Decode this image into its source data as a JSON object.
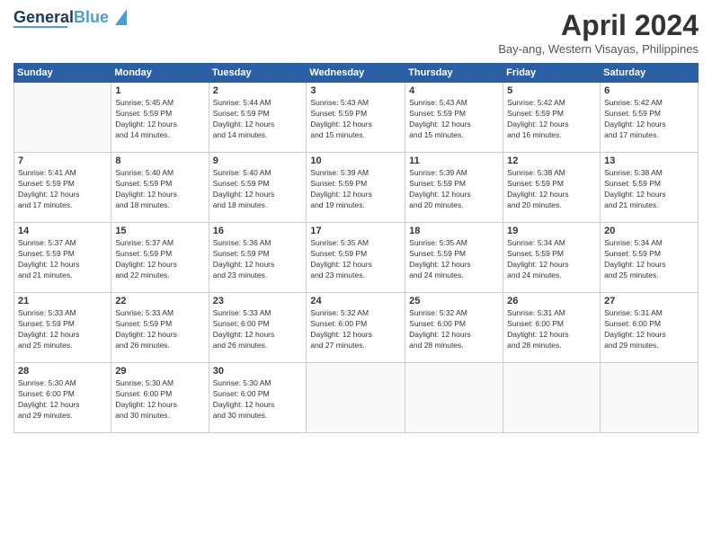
{
  "logo": {
    "line1": "General",
    "line2": "Blue"
  },
  "header": {
    "title": "April 2024",
    "subtitle": "Bay-ang, Western Visayas, Philippines"
  },
  "days_of_week": [
    "Sunday",
    "Monday",
    "Tuesday",
    "Wednesday",
    "Thursday",
    "Friday",
    "Saturday"
  ],
  "weeks": [
    [
      {
        "day": "",
        "info": ""
      },
      {
        "day": "1",
        "info": "Sunrise: 5:45 AM\nSunset: 5:59 PM\nDaylight: 12 hours\nand 14 minutes."
      },
      {
        "day": "2",
        "info": "Sunrise: 5:44 AM\nSunset: 5:59 PM\nDaylight: 12 hours\nand 14 minutes."
      },
      {
        "day": "3",
        "info": "Sunrise: 5:43 AM\nSunset: 5:59 PM\nDaylight: 12 hours\nand 15 minutes."
      },
      {
        "day": "4",
        "info": "Sunrise: 5:43 AM\nSunset: 5:59 PM\nDaylight: 12 hours\nand 15 minutes."
      },
      {
        "day": "5",
        "info": "Sunrise: 5:42 AM\nSunset: 5:59 PM\nDaylight: 12 hours\nand 16 minutes."
      },
      {
        "day": "6",
        "info": "Sunrise: 5:42 AM\nSunset: 5:59 PM\nDaylight: 12 hours\nand 17 minutes."
      }
    ],
    [
      {
        "day": "7",
        "info": "Sunrise: 5:41 AM\nSunset: 5:59 PM\nDaylight: 12 hours\nand 17 minutes."
      },
      {
        "day": "8",
        "info": "Sunrise: 5:40 AM\nSunset: 5:59 PM\nDaylight: 12 hours\nand 18 minutes."
      },
      {
        "day": "9",
        "info": "Sunrise: 5:40 AM\nSunset: 5:59 PM\nDaylight: 12 hours\nand 18 minutes."
      },
      {
        "day": "10",
        "info": "Sunrise: 5:39 AM\nSunset: 5:59 PM\nDaylight: 12 hours\nand 19 minutes."
      },
      {
        "day": "11",
        "info": "Sunrise: 5:39 AM\nSunset: 5:59 PM\nDaylight: 12 hours\nand 20 minutes."
      },
      {
        "day": "12",
        "info": "Sunrise: 5:38 AM\nSunset: 5:59 PM\nDaylight: 12 hours\nand 20 minutes."
      },
      {
        "day": "13",
        "info": "Sunrise: 5:38 AM\nSunset: 5:59 PM\nDaylight: 12 hours\nand 21 minutes."
      }
    ],
    [
      {
        "day": "14",
        "info": "Sunrise: 5:37 AM\nSunset: 5:59 PM\nDaylight: 12 hours\nand 21 minutes."
      },
      {
        "day": "15",
        "info": "Sunrise: 5:37 AM\nSunset: 5:59 PM\nDaylight: 12 hours\nand 22 minutes."
      },
      {
        "day": "16",
        "info": "Sunrise: 5:36 AM\nSunset: 5:59 PM\nDaylight: 12 hours\nand 23 minutes."
      },
      {
        "day": "17",
        "info": "Sunrise: 5:35 AM\nSunset: 5:59 PM\nDaylight: 12 hours\nand 23 minutes."
      },
      {
        "day": "18",
        "info": "Sunrise: 5:35 AM\nSunset: 5:59 PM\nDaylight: 12 hours\nand 24 minutes."
      },
      {
        "day": "19",
        "info": "Sunrise: 5:34 AM\nSunset: 5:59 PM\nDaylight: 12 hours\nand 24 minutes."
      },
      {
        "day": "20",
        "info": "Sunrise: 5:34 AM\nSunset: 5:59 PM\nDaylight: 12 hours\nand 25 minutes."
      }
    ],
    [
      {
        "day": "21",
        "info": "Sunrise: 5:33 AM\nSunset: 5:59 PM\nDaylight: 12 hours\nand 25 minutes."
      },
      {
        "day": "22",
        "info": "Sunrise: 5:33 AM\nSunset: 5:59 PM\nDaylight: 12 hours\nand 26 minutes."
      },
      {
        "day": "23",
        "info": "Sunrise: 5:33 AM\nSunset: 6:00 PM\nDaylight: 12 hours\nand 26 minutes."
      },
      {
        "day": "24",
        "info": "Sunrise: 5:32 AM\nSunset: 6:00 PM\nDaylight: 12 hours\nand 27 minutes."
      },
      {
        "day": "25",
        "info": "Sunrise: 5:32 AM\nSunset: 6:00 PM\nDaylight: 12 hours\nand 28 minutes."
      },
      {
        "day": "26",
        "info": "Sunrise: 5:31 AM\nSunset: 6:00 PM\nDaylight: 12 hours\nand 28 minutes."
      },
      {
        "day": "27",
        "info": "Sunrise: 5:31 AM\nSunset: 6:00 PM\nDaylight: 12 hours\nand 29 minutes."
      }
    ],
    [
      {
        "day": "28",
        "info": "Sunrise: 5:30 AM\nSunset: 6:00 PM\nDaylight: 12 hours\nand 29 minutes."
      },
      {
        "day": "29",
        "info": "Sunrise: 5:30 AM\nSunset: 6:00 PM\nDaylight: 12 hours\nand 30 minutes."
      },
      {
        "day": "30",
        "info": "Sunrise: 5:30 AM\nSunset: 6:00 PM\nDaylight: 12 hours\nand 30 minutes."
      },
      {
        "day": "",
        "info": ""
      },
      {
        "day": "",
        "info": ""
      },
      {
        "day": "",
        "info": ""
      },
      {
        "day": "",
        "info": ""
      }
    ]
  ]
}
